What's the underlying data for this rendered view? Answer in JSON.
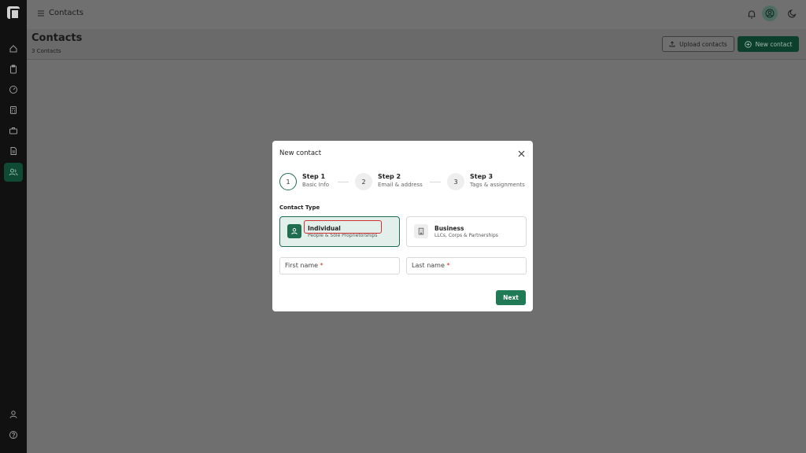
{
  "topbar": {
    "breadcrumb": "Contacts"
  },
  "header": {
    "title": "Contacts",
    "subtitle": "3 Contacts",
    "upload_label": "Upload contacts",
    "new_label": "New contact"
  },
  "sidebar": {
    "items": [
      {
        "icon": "home-icon"
      },
      {
        "icon": "clipboard-icon"
      },
      {
        "icon": "gauge-icon"
      },
      {
        "icon": "calculator-icon"
      },
      {
        "icon": "briefcase-icon"
      },
      {
        "icon": "document-icon"
      },
      {
        "icon": "users-icon",
        "active": true
      },
      {
        "icon": "user-icon"
      },
      {
        "icon": "help-icon"
      }
    ]
  },
  "modal": {
    "title": "New contact",
    "steps": [
      {
        "number": "1",
        "title": "Step 1",
        "desc": "Basic Info"
      },
      {
        "number": "2",
        "title": "Step 2",
        "desc": "Email & address"
      },
      {
        "number": "3",
        "title": "Step 3",
        "desc": "Tags & assignments"
      }
    ],
    "section_label": "Contact Type",
    "types": {
      "individual": {
        "title": "Individual",
        "desc": "People & Sole Proprietorships"
      },
      "business": {
        "title": "Business",
        "desc": "LLCs, Corps & Partnerships"
      }
    },
    "fields": {
      "first_name": "First name",
      "last_name": "Last name",
      "required_mark": "*"
    },
    "next_label": "Next"
  },
  "colors": {
    "accent": "#1f7a55",
    "highlight": "#d0302f",
    "sidebar_bg": "#111111"
  }
}
